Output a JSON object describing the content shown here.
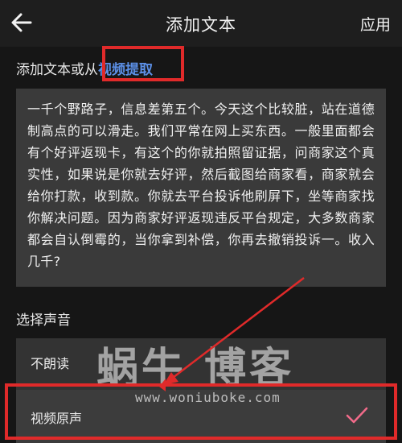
{
  "header": {
    "title": "添加文本",
    "apply_label": "应用",
    "back_icon": "arrow-left-icon"
  },
  "text_source": {
    "prefix": "添加文本或从",
    "link_label": "视频提取"
  },
  "text_content": "一千个野路子，信息差第五个。今天这个比较脏，站在道德制高点的可以滑走。我们平常在网上买东西。一般里面都会有个好评返现卡，有这个的你就拍照留证据，问商家这个真实性，如果说是你就去好评，然后截图给商家看，商家就会给你打款，收到款。你就去平台投诉他刷屏下，坐等商家找你解决问题。因为商家好评返现违反平台规定，大多数商家都会自认倒霉的，当你拿到补偿，你再去撤销投诉一。收入几千?",
  "voice": {
    "label": "选择声音",
    "options": [
      {
        "label": "不朗读",
        "selected": false
      },
      {
        "label": "视频原声",
        "selected": true
      }
    ],
    "check_icon": "checkmark-icon"
  },
  "watermark": {
    "main": "蜗牛      博客",
    "url": "www.woniuboke.com"
  },
  "colors": {
    "background": "#161616",
    "panel": "#3a3a3a",
    "link": "#5b8fe6",
    "annotation": "#e02a2a",
    "check": "#f26b8a"
  }
}
